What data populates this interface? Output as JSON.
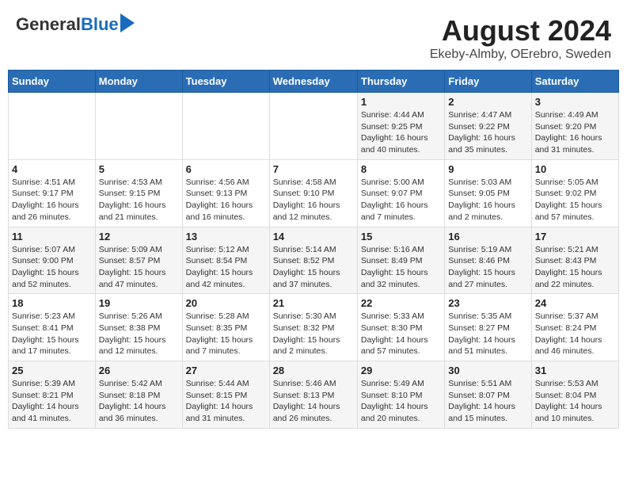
{
  "header": {
    "logo_general": "General",
    "logo_blue": "Blue",
    "title": "August 2024",
    "subtitle": "Ekeby-Almby, OErebro, Sweden"
  },
  "weekdays": [
    "Sunday",
    "Monday",
    "Tuesday",
    "Wednesday",
    "Thursday",
    "Friday",
    "Saturday"
  ],
  "weeks": [
    [
      {
        "day": "",
        "info": ""
      },
      {
        "day": "",
        "info": ""
      },
      {
        "day": "",
        "info": ""
      },
      {
        "day": "",
        "info": ""
      },
      {
        "day": "1",
        "info": "Sunrise: 4:44 AM\nSunset: 9:25 PM\nDaylight: 16 hours and 40 minutes."
      },
      {
        "day": "2",
        "info": "Sunrise: 4:47 AM\nSunset: 9:22 PM\nDaylight: 16 hours and 35 minutes."
      },
      {
        "day": "3",
        "info": "Sunrise: 4:49 AM\nSunset: 9:20 PM\nDaylight: 16 hours and 31 minutes."
      }
    ],
    [
      {
        "day": "4",
        "info": "Sunrise: 4:51 AM\nSunset: 9:17 PM\nDaylight: 16 hours and 26 minutes."
      },
      {
        "day": "5",
        "info": "Sunrise: 4:53 AM\nSunset: 9:15 PM\nDaylight: 16 hours and 21 minutes."
      },
      {
        "day": "6",
        "info": "Sunrise: 4:56 AM\nSunset: 9:13 PM\nDaylight: 16 hours and 16 minutes."
      },
      {
        "day": "7",
        "info": "Sunrise: 4:58 AM\nSunset: 9:10 PM\nDaylight: 16 hours and 12 minutes."
      },
      {
        "day": "8",
        "info": "Sunrise: 5:00 AM\nSunset: 9:07 PM\nDaylight: 16 hours and 7 minutes."
      },
      {
        "day": "9",
        "info": "Sunrise: 5:03 AM\nSunset: 9:05 PM\nDaylight: 16 hours and 2 minutes."
      },
      {
        "day": "10",
        "info": "Sunrise: 5:05 AM\nSunset: 9:02 PM\nDaylight: 15 hours and 57 minutes."
      }
    ],
    [
      {
        "day": "11",
        "info": "Sunrise: 5:07 AM\nSunset: 9:00 PM\nDaylight: 15 hours and 52 minutes."
      },
      {
        "day": "12",
        "info": "Sunrise: 5:09 AM\nSunset: 8:57 PM\nDaylight: 15 hours and 47 minutes."
      },
      {
        "day": "13",
        "info": "Sunrise: 5:12 AM\nSunset: 8:54 PM\nDaylight: 15 hours and 42 minutes."
      },
      {
        "day": "14",
        "info": "Sunrise: 5:14 AM\nSunset: 8:52 PM\nDaylight: 15 hours and 37 minutes."
      },
      {
        "day": "15",
        "info": "Sunrise: 5:16 AM\nSunset: 8:49 PM\nDaylight: 15 hours and 32 minutes."
      },
      {
        "day": "16",
        "info": "Sunrise: 5:19 AM\nSunset: 8:46 PM\nDaylight: 15 hours and 27 minutes."
      },
      {
        "day": "17",
        "info": "Sunrise: 5:21 AM\nSunset: 8:43 PM\nDaylight: 15 hours and 22 minutes."
      }
    ],
    [
      {
        "day": "18",
        "info": "Sunrise: 5:23 AM\nSunset: 8:41 PM\nDaylight: 15 hours and 17 minutes."
      },
      {
        "day": "19",
        "info": "Sunrise: 5:26 AM\nSunset: 8:38 PM\nDaylight: 15 hours and 12 minutes."
      },
      {
        "day": "20",
        "info": "Sunrise: 5:28 AM\nSunset: 8:35 PM\nDaylight: 15 hours and 7 minutes."
      },
      {
        "day": "21",
        "info": "Sunrise: 5:30 AM\nSunset: 8:32 PM\nDaylight: 15 hours and 2 minutes."
      },
      {
        "day": "22",
        "info": "Sunrise: 5:33 AM\nSunset: 8:30 PM\nDaylight: 14 hours and 57 minutes."
      },
      {
        "day": "23",
        "info": "Sunrise: 5:35 AM\nSunset: 8:27 PM\nDaylight: 14 hours and 51 minutes."
      },
      {
        "day": "24",
        "info": "Sunrise: 5:37 AM\nSunset: 8:24 PM\nDaylight: 14 hours and 46 minutes."
      }
    ],
    [
      {
        "day": "25",
        "info": "Sunrise: 5:39 AM\nSunset: 8:21 PM\nDaylight: 14 hours and 41 minutes."
      },
      {
        "day": "26",
        "info": "Sunrise: 5:42 AM\nSunset: 8:18 PM\nDaylight: 14 hours and 36 minutes."
      },
      {
        "day": "27",
        "info": "Sunrise: 5:44 AM\nSunset: 8:15 PM\nDaylight: 14 hours and 31 minutes."
      },
      {
        "day": "28",
        "info": "Sunrise: 5:46 AM\nSunset: 8:13 PM\nDaylight: 14 hours and 26 minutes."
      },
      {
        "day": "29",
        "info": "Sunrise: 5:49 AM\nSunset: 8:10 PM\nDaylight: 14 hours and 20 minutes."
      },
      {
        "day": "30",
        "info": "Sunrise: 5:51 AM\nSunset: 8:07 PM\nDaylight: 14 hours and 15 minutes."
      },
      {
        "day": "31",
        "info": "Sunrise: 5:53 AM\nSunset: 8:04 PM\nDaylight: 14 hours and 10 minutes."
      }
    ]
  ]
}
